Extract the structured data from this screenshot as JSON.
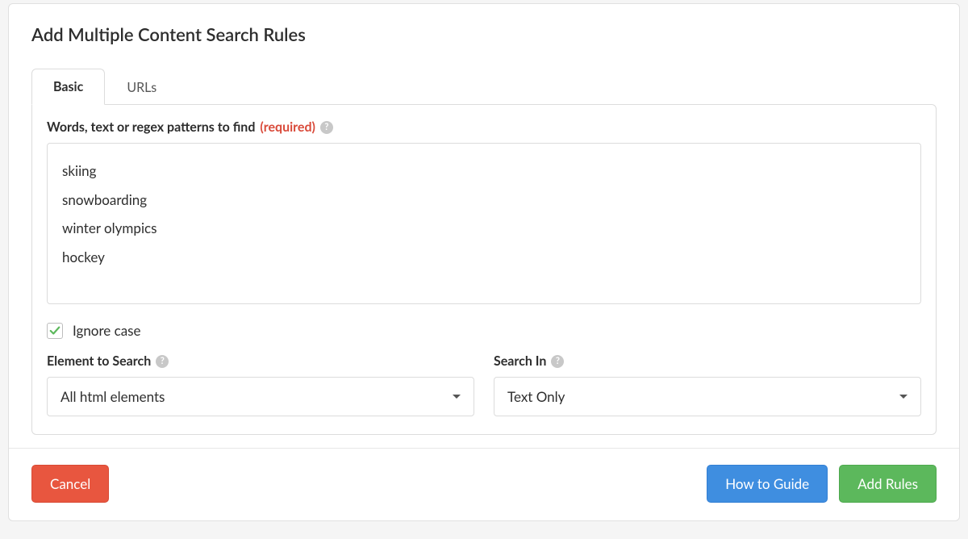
{
  "modal": {
    "title": "Add Multiple Content Search Rules",
    "tabs": [
      {
        "label": "Basic",
        "active": true
      },
      {
        "label": "URLs",
        "active": false
      }
    ]
  },
  "form": {
    "patterns_label_prefix": "Words, text or regex patterns to find ",
    "patterns_required": "(required)",
    "patterns_value": "skiing\nsnowboarding\nwinter olympics\nhockey",
    "ignore_case_checked": true,
    "ignore_case_label": "Ignore case",
    "element_label": "Element to Search",
    "element_value": "All html elements",
    "search_in_label": "Search In",
    "search_in_value": "Text Only"
  },
  "footer": {
    "cancel": "Cancel",
    "guide": "How to Guide",
    "submit": "Add Rules"
  },
  "icons": {
    "help": "?"
  },
  "colors": {
    "danger": "#e8563f",
    "primary": "#3f8ee0",
    "success": "#5cb85c",
    "check": "#5cb85c"
  }
}
